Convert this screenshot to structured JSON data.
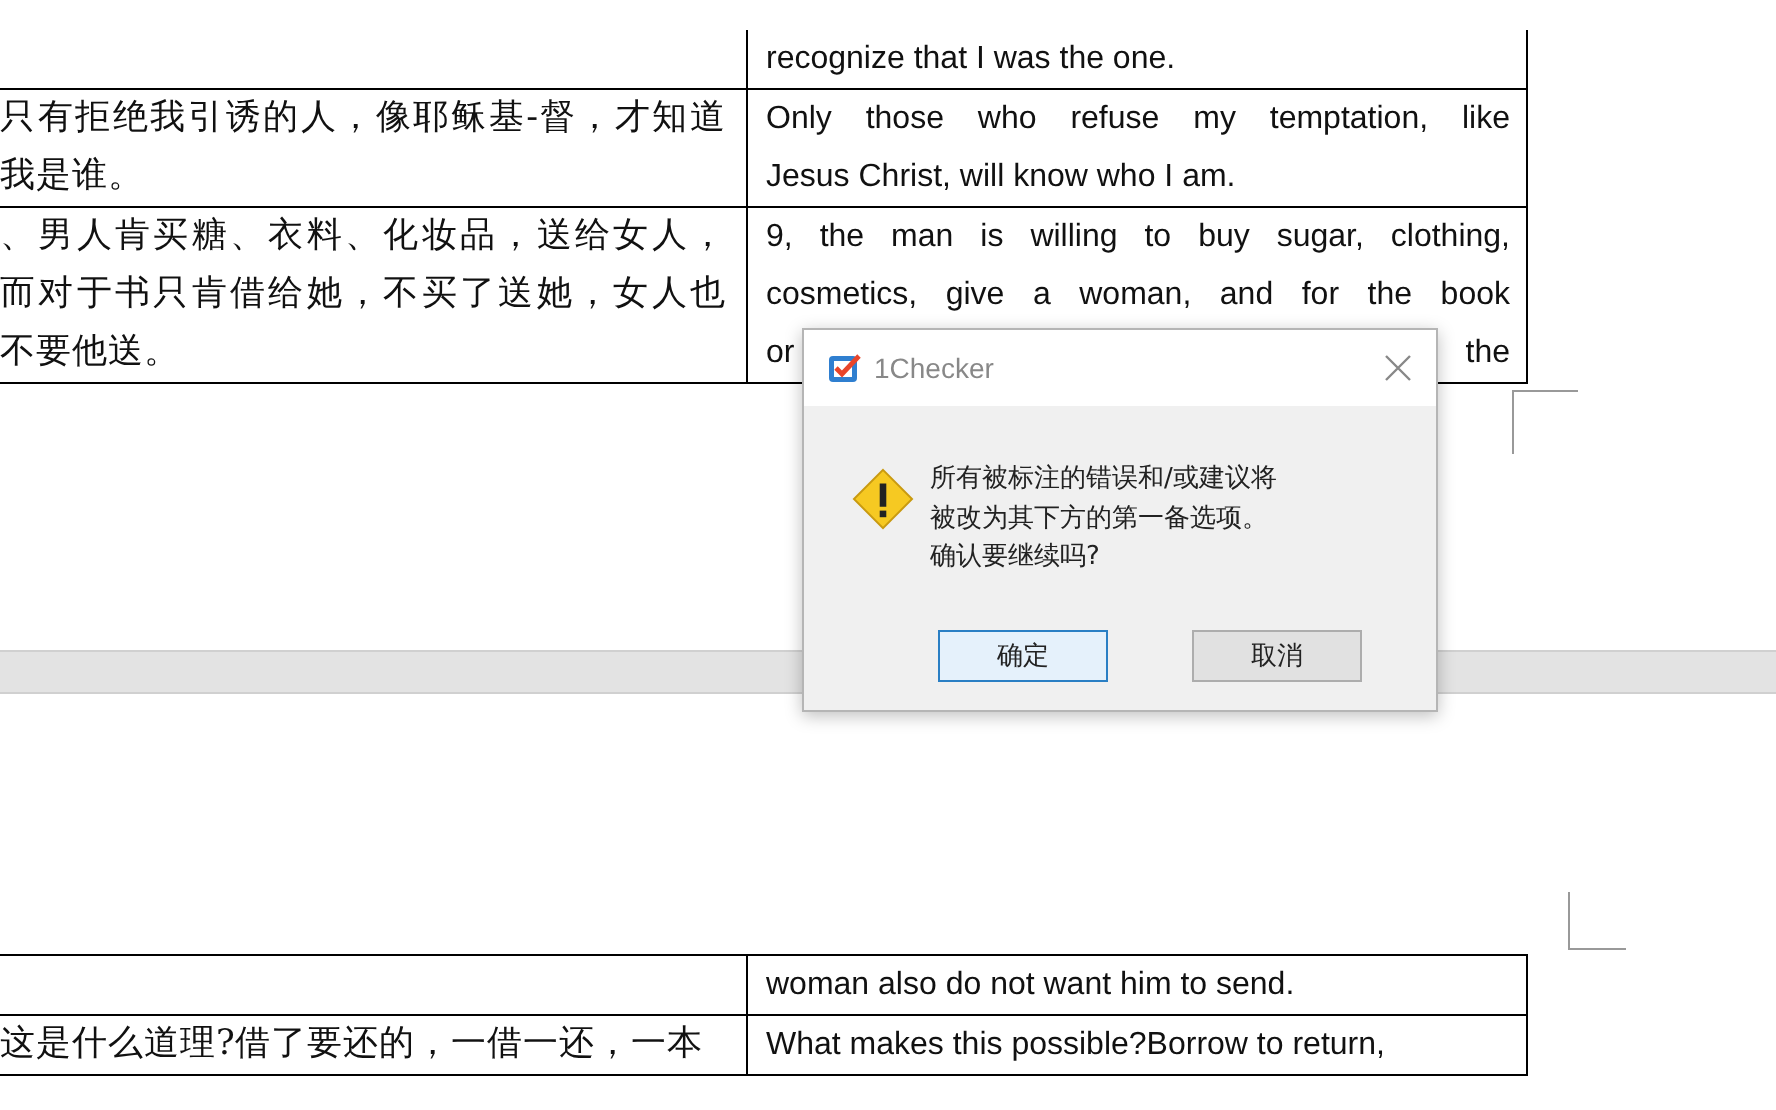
{
  "document": {
    "page_1_rows": [
      {
        "chinese": [],
        "english": [
          "recognize that I was the one."
        ]
      },
      {
        "chinese": [
          "只有拒绝我引诱的人，像耶稣基-督，才知道",
          "我是谁。"
        ],
        "english": [
          "Only those who refuse my temptation, like",
          "Jesus Christ, will know who I am."
        ]
      },
      {
        "chinese": [
          "、男人肯买糖、衣料、化妆品，送给女人，",
          "而对于书只肯借给她，不买了送她，女人也",
          "不要他送。"
        ],
        "english": [
          "9, the man is willing to buy sugar, clothing,",
          "cosmetics, give a woman, and for the book",
          [
            "or",
            "the"
          ]
        ]
      }
    ],
    "page_2_rows": [
      {
        "chinese": [],
        "english": [
          "woman also do not want him to send."
        ]
      },
      {
        "chinese": [
          "这是什么道理?借了要还的，一借一还，一本"
        ],
        "english": [
          "What makes this possible?Borrow to return,"
        ]
      }
    ]
  },
  "dialog": {
    "title": "1Checker",
    "message": [
      "所有被标注的错误和/或建议将",
      "被改为其下方的第一备选项。",
      "确认要继续吗?"
    ],
    "buttons": [
      {
        "label": "确定",
        "selected": true
      },
      {
        "label": "取消",
        "selected": false
      }
    ]
  }
}
